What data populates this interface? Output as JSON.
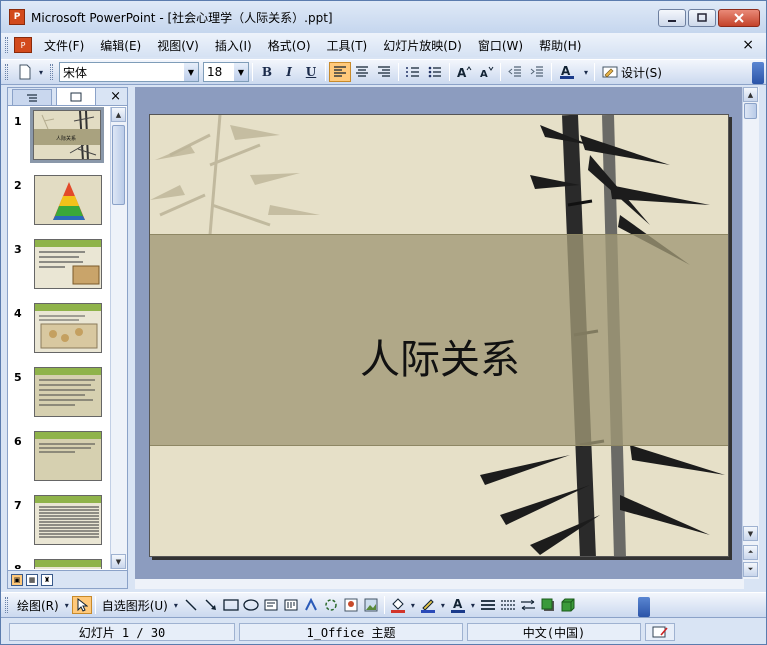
{
  "window": {
    "title": "Microsoft PowerPoint - [社会心理学（人际关系）.ppt]",
    "app_icon": "P"
  },
  "menu": {
    "items": [
      "文件(F)",
      "编辑(E)",
      "视图(V)",
      "插入(I)",
      "格式(O)",
      "工具(T)",
      "幻灯片放映(D)",
      "窗口(W)",
      "帮助(H)"
    ],
    "close_glyph": "×"
  },
  "toolbar": {
    "font_name": "宋体",
    "font_size": "18",
    "bold": "B",
    "italic": "I",
    "underline": "U",
    "design_label": "设计(S)"
  },
  "thumbnails": {
    "numbers": [
      "1",
      "2",
      "3",
      "4",
      "5",
      "6",
      "7",
      "8"
    ],
    "slide1_title": "人际关系",
    "close_glyph": "×"
  },
  "slide": {
    "title": "人际关系"
  },
  "drawing_toolbar": {
    "draw_label": "绘图(R)",
    "autoshapes_label": "自选图形(U)"
  },
  "status": {
    "slide_position": "幻灯片 1 / 30",
    "theme": "1_Office 主题",
    "language": "中文(中国)"
  },
  "colors": {
    "slide_background": "#e6e0c8",
    "title_band": "#a09976",
    "stage_background": "#8c9cbf",
    "thumb_header_green": "#8fb34a"
  }
}
